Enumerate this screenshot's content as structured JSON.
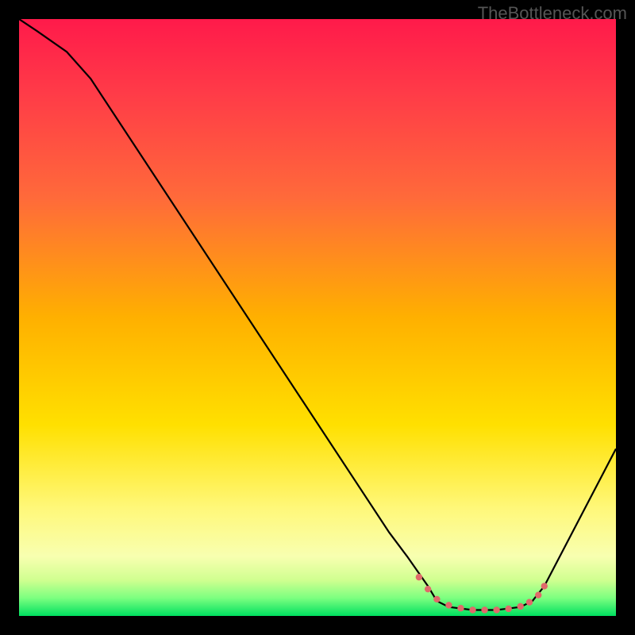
{
  "watermark": "TheBottleneck.com",
  "chart_data": {
    "type": "line",
    "title": "",
    "xlabel": "",
    "ylabel": "",
    "xlim": [
      0,
      100
    ],
    "ylim": [
      0,
      100
    ],
    "gradient_stops": [
      {
        "offset": 0,
        "color": "#ff1a4a"
      },
      {
        "offset": 12,
        "color": "#ff3a48"
      },
      {
        "offset": 30,
        "color": "#ff6a3a"
      },
      {
        "offset": 50,
        "color": "#ffb000"
      },
      {
        "offset": 68,
        "color": "#ffe000"
      },
      {
        "offset": 82,
        "color": "#fff87a"
      },
      {
        "offset": 90,
        "color": "#f8ffb0"
      },
      {
        "offset": 94,
        "color": "#d0ff90"
      },
      {
        "offset": 97,
        "color": "#7cff80"
      },
      {
        "offset": 100,
        "color": "#00e060"
      }
    ],
    "series": [
      {
        "name": "curve",
        "stroke": "#000000",
        "points": [
          {
            "x": 0,
            "y": 100
          },
          {
            "x": 3,
            "y": 98
          },
          {
            "x": 8,
            "y": 94.5
          },
          {
            "x": 12,
            "y": 90
          },
          {
            "x": 62,
            "y": 14
          },
          {
            "x": 65,
            "y": 10
          },
          {
            "x": 68.5,
            "y": 5
          },
          {
            "x": 70,
            "y": 2.5
          },
          {
            "x": 72,
            "y": 1.5
          },
          {
            "x": 76,
            "y": 1
          },
          {
            "x": 80,
            "y": 1
          },
          {
            "x": 84,
            "y": 1.5
          },
          {
            "x": 86,
            "y": 2.5
          },
          {
            "x": 88,
            "y": 5
          },
          {
            "x": 100,
            "y": 28
          }
        ]
      }
    ],
    "dotted_overlay": {
      "stroke": "#e06a6a",
      "points": [
        {
          "x": 67,
          "y": 6.5
        },
        {
          "x": 68.5,
          "y": 4.5
        },
        {
          "x": 70,
          "y": 2.8
        },
        {
          "x": 72,
          "y": 1.8
        },
        {
          "x": 74,
          "y": 1.3
        },
        {
          "x": 76,
          "y": 1.0
        },
        {
          "x": 78,
          "y": 1.0
        },
        {
          "x": 80,
          "y": 1.0
        },
        {
          "x": 82,
          "y": 1.2
        },
        {
          "x": 84,
          "y": 1.6
        },
        {
          "x": 85.5,
          "y": 2.3
        },
        {
          "x": 87,
          "y": 3.5
        },
        {
          "x": 88,
          "y": 5.0
        }
      ]
    }
  }
}
